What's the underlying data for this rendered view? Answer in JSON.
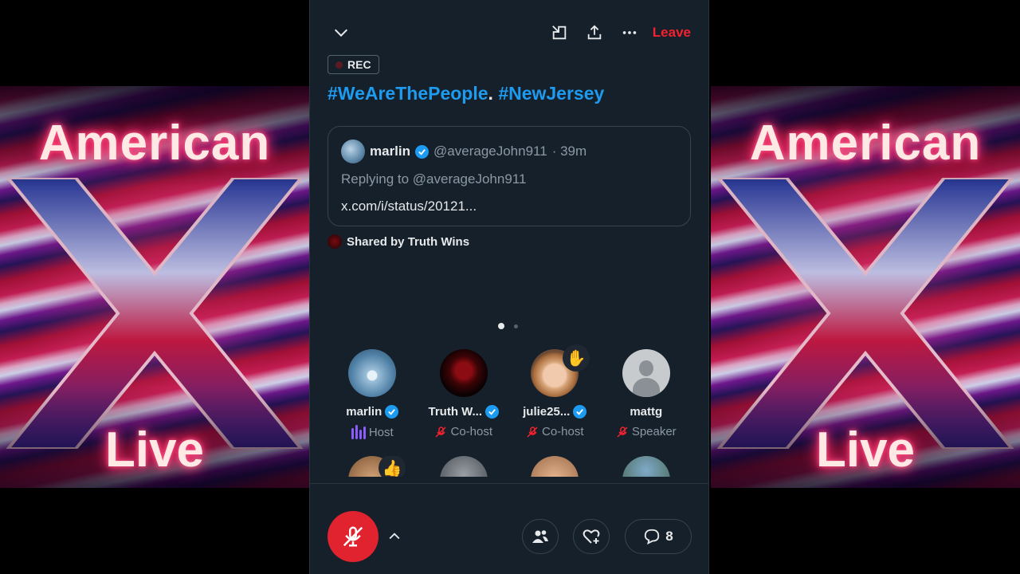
{
  "banner": {
    "title": "American",
    "subtitle": "Live"
  },
  "topbar": {
    "leave_label": "Leave"
  },
  "rec_label": "REC",
  "headline": {
    "tag1": "#WeAreThePeople",
    "separator": ". ",
    "tag2": "#NewJersey"
  },
  "tweet": {
    "name": "marlin",
    "handle": "@averageJohn911",
    "time": "· 39m",
    "reply": "Replying to @averageJohn911",
    "link": "x.com/i/status/20121..."
  },
  "shared_by": "Shared by Truth Wins",
  "pager": {
    "pages": 2,
    "current": 1
  },
  "participants": [
    {
      "name": "marlin",
      "role": "Host",
      "verified": true
    },
    {
      "name": "Truth W...",
      "role": "Co-host",
      "verified": true
    },
    {
      "name": "julie25...",
      "role": "Co-host",
      "verified": true,
      "hand": "✋"
    },
    {
      "name": "mattg",
      "role": "Speaker",
      "verified": false
    }
  ],
  "row2_badge": "👍",
  "comments_count": "8",
  "icons": [
    "chevron-down-icon",
    "minimize-icon",
    "share-icon",
    "more-icon",
    "mic-off-icon",
    "chevron-up-icon",
    "people-icon",
    "heart-plus-icon",
    "comment-icon"
  ],
  "colors": {
    "accent": "#1d9bf0",
    "danger": "#f4212e",
    "panel": "#16202a",
    "speaking": "#8c5cff"
  }
}
